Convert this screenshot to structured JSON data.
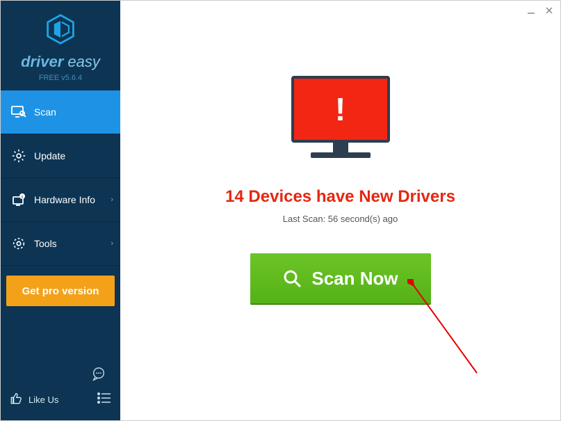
{
  "brand": {
    "name_part1": "driver",
    "name_part2": "easy",
    "version": "FREE v5.6.4"
  },
  "sidebar": {
    "items": [
      {
        "label": "Scan"
      },
      {
        "label": "Update"
      },
      {
        "label": "Hardware Info"
      },
      {
        "label": "Tools"
      }
    ],
    "pro_button": "Get pro version",
    "like_label": "Like Us"
  },
  "main": {
    "headline": "14 Devices have New Drivers",
    "last_scan": "Last Scan: 56 second(s) ago",
    "scan_button": "Scan Now"
  },
  "colors": {
    "sidebar_bg": "#0d3452",
    "active_nav": "#1e93e5",
    "pro_btn": "#f4a11a",
    "alert_red": "#e52712",
    "scan_green": "#55b118"
  }
}
